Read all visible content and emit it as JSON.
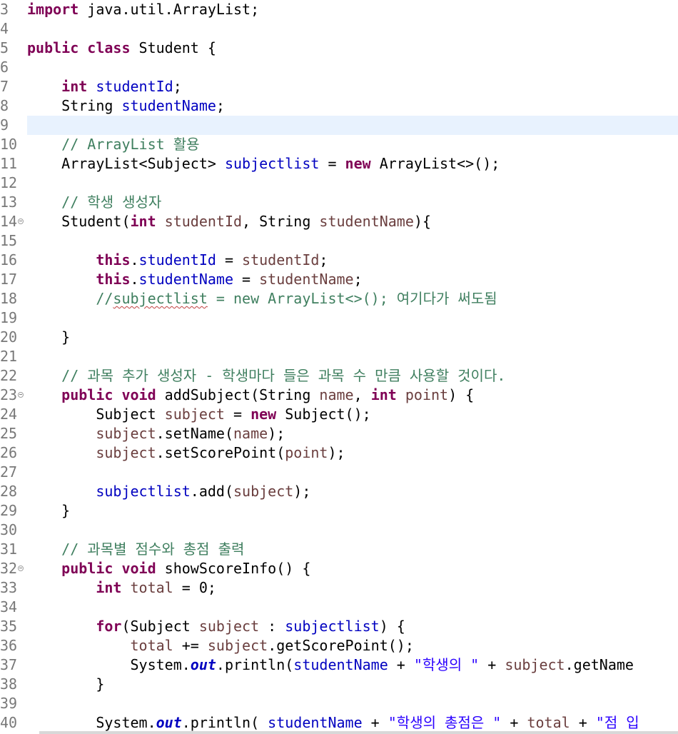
{
  "editor": {
    "current_line": 9,
    "colors": {
      "keyword": "#7f0055",
      "field": "#0000c0",
      "local_variable": "#6a3e3e",
      "comment": "#3f7f5f",
      "string": "#2a00ff",
      "line_number": "#787878",
      "current_line_highlight": "#e8f2fe"
    },
    "lines": [
      {
        "num": "3",
        "tokens": [
          [
            "kw",
            "import"
          ],
          [
            "p",
            " java.util.ArrayList;"
          ]
        ]
      },
      {
        "num": "4",
        "tokens": []
      },
      {
        "num": "5",
        "tokens": [
          [
            "kw",
            "public"
          ],
          [
            "p",
            " "
          ],
          [
            "kw",
            "class"
          ],
          [
            "p",
            " Student {"
          ]
        ]
      },
      {
        "num": "6",
        "tokens": []
      },
      {
        "num": "7",
        "tokens": [
          [
            "p",
            "    "
          ],
          [
            "kw",
            "int"
          ],
          [
            "p",
            " "
          ],
          [
            "f",
            "studentId"
          ],
          [
            "p",
            ";"
          ]
        ]
      },
      {
        "num": "8",
        "tokens": [
          [
            "p",
            "    String "
          ],
          [
            "f",
            "studentName"
          ],
          [
            "p",
            ";"
          ]
        ]
      },
      {
        "num": "9",
        "tokens": []
      },
      {
        "num": "10",
        "tokens": [
          [
            "p",
            "    "
          ],
          [
            "c",
            "// ArrayList 활용"
          ]
        ]
      },
      {
        "num": "11",
        "tokens": [
          [
            "p",
            "    ArrayList<Subject> "
          ],
          [
            "f",
            "subjectlist"
          ],
          [
            "p",
            " = "
          ],
          [
            "kw",
            "new"
          ],
          [
            "p",
            " ArrayList<>();"
          ]
        ]
      },
      {
        "num": "12",
        "tokens": []
      },
      {
        "num": "13",
        "tokens": [
          [
            "p",
            "    "
          ],
          [
            "c",
            "// 학생 생성자"
          ]
        ]
      },
      {
        "num": "14",
        "fold": true,
        "tokens": [
          [
            "p",
            "    Student("
          ],
          [
            "kw",
            "int"
          ],
          [
            "p",
            " "
          ],
          [
            "v",
            "studentId"
          ],
          [
            "p",
            ", String "
          ],
          [
            "v",
            "studentName"
          ],
          [
            "p",
            "){"
          ]
        ]
      },
      {
        "num": "15",
        "tokens": []
      },
      {
        "num": "16",
        "tokens": [
          [
            "p",
            "        "
          ],
          [
            "kw",
            "this"
          ],
          [
            "p",
            "."
          ],
          [
            "f",
            "studentId"
          ],
          [
            "p",
            " = "
          ],
          [
            "v",
            "studentId"
          ],
          [
            "p",
            ";"
          ]
        ]
      },
      {
        "num": "17",
        "tokens": [
          [
            "p",
            "        "
          ],
          [
            "kw",
            "this"
          ],
          [
            "p",
            "."
          ],
          [
            "f",
            "studentName"
          ],
          [
            "p",
            " = "
          ],
          [
            "v",
            "studentName"
          ],
          [
            "p",
            ";"
          ]
        ]
      },
      {
        "num": "18",
        "tokens": [
          [
            "p",
            "        "
          ],
          [
            "c",
            "//"
          ],
          [
            "cs",
            "subjectlist"
          ],
          [
            "c",
            " = new ArrayList<>(); 여기다가 써도됨"
          ]
        ]
      },
      {
        "num": "19",
        "tokens": []
      },
      {
        "num": "20",
        "tokens": [
          [
            "p",
            "    }"
          ]
        ]
      },
      {
        "num": "21",
        "tokens": []
      },
      {
        "num": "22",
        "tokens": [
          [
            "p",
            "    "
          ],
          [
            "c",
            "// 과목 추가 생성자 - 학생마다 들은 과목 수 만큼 사용할 것이다."
          ]
        ]
      },
      {
        "num": "23",
        "fold": true,
        "tokens": [
          [
            "p",
            "    "
          ],
          [
            "kw",
            "public"
          ],
          [
            "p",
            " "
          ],
          [
            "kw",
            "void"
          ],
          [
            "p",
            " addSubject(String "
          ],
          [
            "v",
            "name"
          ],
          [
            "p",
            ", "
          ],
          [
            "kw",
            "int"
          ],
          [
            "p",
            " "
          ],
          [
            "v",
            "point"
          ],
          [
            "p",
            ") {"
          ]
        ]
      },
      {
        "num": "24",
        "tokens": [
          [
            "p",
            "        Subject "
          ],
          [
            "v",
            "subject"
          ],
          [
            "p",
            " = "
          ],
          [
            "kw",
            "new"
          ],
          [
            "p",
            " Subject();"
          ]
        ]
      },
      {
        "num": "25",
        "tokens": [
          [
            "p",
            "        "
          ],
          [
            "v",
            "subject"
          ],
          [
            "p",
            ".setName("
          ],
          [
            "v",
            "name"
          ],
          [
            "p",
            ");"
          ]
        ]
      },
      {
        "num": "26",
        "tokens": [
          [
            "p",
            "        "
          ],
          [
            "v",
            "subject"
          ],
          [
            "p",
            ".setScorePoint("
          ],
          [
            "v",
            "point"
          ],
          [
            "p",
            ");"
          ]
        ]
      },
      {
        "num": "27",
        "tokens": []
      },
      {
        "num": "28",
        "tokens": [
          [
            "p",
            "        "
          ],
          [
            "f",
            "subjectlist"
          ],
          [
            "p",
            ".add("
          ],
          [
            "v",
            "subject"
          ],
          [
            "p",
            ");"
          ]
        ]
      },
      {
        "num": "29",
        "tokens": [
          [
            "p",
            "    }"
          ]
        ]
      },
      {
        "num": "30",
        "tokens": []
      },
      {
        "num": "31",
        "tokens": [
          [
            "p",
            "    "
          ],
          [
            "c",
            "// 과목별 점수와 총점 출력"
          ]
        ]
      },
      {
        "num": "32",
        "fold": true,
        "tokens": [
          [
            "p",
            "    "
          ],
          [
            "kw",
            "public"
          ],
          [
            "p",
            " "
          ],
          [
            "kw",
            "void"
          ],
          [
            "p",
            " showScoreInfo() {"
          ]
        ]
      },
      {
        "num": "33",
        "tokens": [
          [
            "p",
            "        "
          ],
          [
            "kw",
            "int"
          ],
          [
            "p",
            " "
          ],
          [
            "v",
            "total"
          ],
          [
            "p",
            " = 0;"
          ]
        ]
      },
      {
        "num": "34",
        "tokens": []
      },
      {
        "num": "35",
        "tokens": [
          [
            "p",
            "        "
          ],
          [
            "kw",
            "for"
          ],
          [
            "p",
            "(Subject "
          ],
          [
            "v",
            "subject"
          ],
          [
            "p",
            " : "
          ],
          [
            "f",
            "subjectlist"
          ],
          [
            "p",
            ") {"
          ]
        ]
      },
      {
        "num": "36",
        "tokens": [
          [
            "p",
            "            "
          ],
          [
            "v",
            "total"
          ],
          [
            "p",
            " += "
          ],
          [
            "v",
            "subject"
          ],
          [
            "p",
            ".getScorePoint();"
          ]
        ]
      },
      {
        "num": "37",
        "tokens": [
          [
            "p",
            "            System."
          ],
          [
            "s",
            "out"
          ],
          [
            "p",
            ".println("
          ],
          [
            "f",
            "studentName"
          ],
          [
            "p",
            " + "
          ],
          [
            "str",
            "\"학생의 \""
          ],
          [
            "p",
            " + "
          ],
          [
            "v",
            "subject"
          ],
          [
            "p",
            ".getName"
          ]
        ]
      },
      {
        "num": "38",
        "tokens": [
          [
            "p",
            "        }"
          ]
        ]
      },
      {
        "num": "39",
        "tokens": []
      },
      {
        "num": "40",
        "tokens": [
          [
            "p",
            "        System."
          ],
          [
            "s",
            "out"
          ],
          [
            "p",
            ".println( "
          ],
          [
            "f",
            "studentName"
          ],
          [
            "p",
            " + "
          ],
          [
            "str",
            "\"학생의 총점은 \""
          ],
          [
            "p",
            " + "
          ],
          [
            "v",
            "total"
          ],
          [
            "p",
            " + "
          ],
          [
            "str",
            "\"점 입"
          ]
        ]
      }
    ]
  }
}
